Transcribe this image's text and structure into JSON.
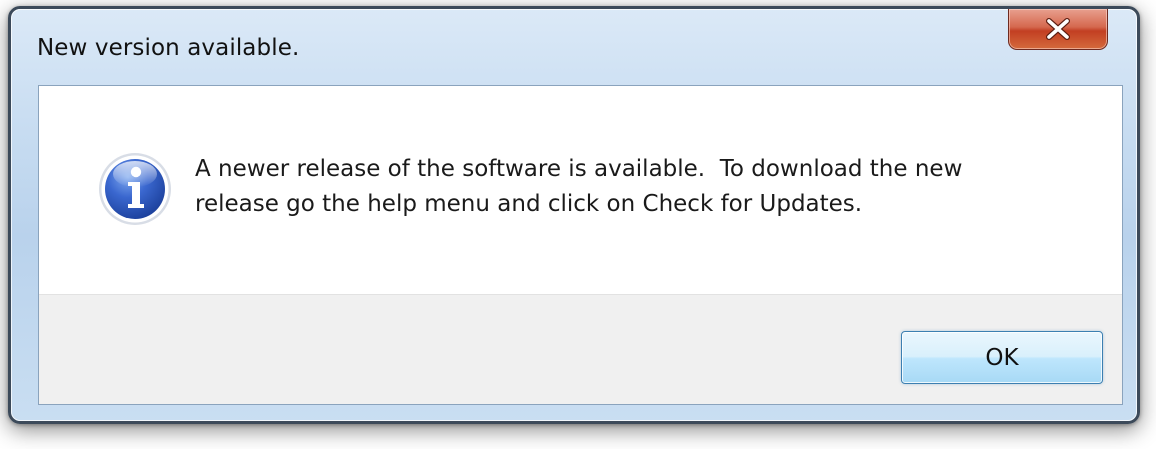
{
  "dialog": {
    "title": "New version available.",
    "close_icon": "close-icon",
    "info_icon": "information-icon",
    "message_line_1": "A newer release of the software is available.  To download the new",
    "message_line_2": "release go the help menu and click on Check for Updates.",
    "ok_label": "OK"
  },
  "colors": {
    "close_button": "#c94a2f",
    "info_icon_blue": "#2a55b8",
    "footer_background": "#f0f0f0",
    "ok_button_border": "#3c7fb1"
  }
}
